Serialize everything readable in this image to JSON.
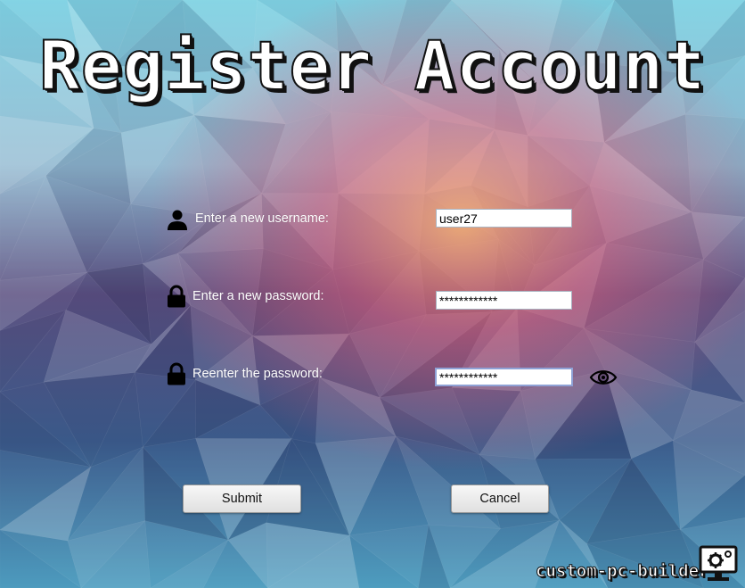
{
  "title": "Register Account",
  "form": {
    "username": {
      "label": "Enter a new username:",
      "value": "user27",
      "icon": "person-icon"
    },
    "password": {
      "label": "Enter a  new password:",
      "value": "************",
      "icon": "lock-icon"
    },
    "confirm_password": {
      "label": "Reenter the password:",
      "value": "************",
      "icon": "lock-icon",
      "toggle_icon": "eye-icon"
    }
  },
  "buttons": {
    "submit": "Submit",
    "cancel": "Cancel"
  },
  "brand": {
    "name": "custom-pc-builder",
    "icon": "monitor-gear-icon"
  },
  "colors": {
    "label_text": "#ffffff",
    "field_border": "#a9b4c2",
    "focused_border": "#8fa2d6"
  }
}
